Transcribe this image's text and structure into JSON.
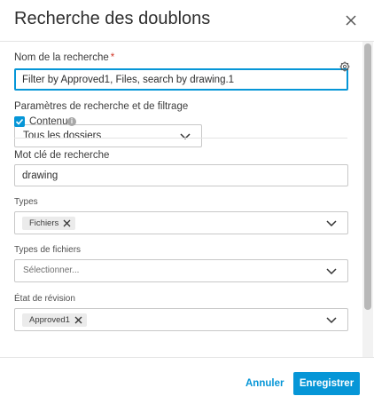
{
  "dialog": {
    "title": "Recherche des doublons",
    "close_icon": "close-icon"
  },
  "search_name": {
    "label": "Nom de la recherche",
    "required_mark": "*",
    "value": "Filter by Approved1, Files, search by drawing.1"
  },
  "filter_params": {
    "label": "Paramètres de recherche et de filtrage",
    "settings_icon": "gear-icon",
    "folder_select": {
      "value": "Tous les dossiers"
    },
    "content_checkbox": {
      "label": "Contenu",
      "checked": true,
      "info_glyph": "i"
    }
  },
  "keyword": {
    "label": "Mot clé de recherche",
    "value": "drawing"
  },
  "types": {
    "label": "Types",
    "chips": [
      "Fichiers"
    ]
  },
  "file_types": {
    "label": "Types de fichiers",
    "placeholder": "Sélectionner..."
  },
  "revision_state": {
    "label": "État de révision",
    "chips": [
      "Approved1"
    ]
  },
  "footer": {
    "cancel_label": "Annuler",
    "save_label": "Enregistrer"
  },
  "colors": {
    "accent": "#0696d7",
    "required": "#d23a2b"
  }
}
